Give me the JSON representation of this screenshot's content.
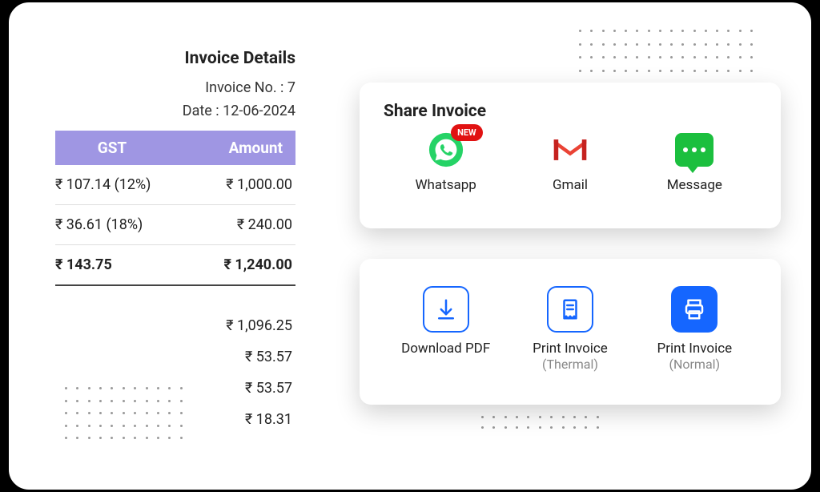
{
  "invoice": {
    "title": "Invoice Details",
    "invoice_no_label": "Invoice No. : 7",
    "date_label": "Date : 12-06-2024",
    "headers": {
      "gst": "GST",
      "amount": "Amount"
    },
    "rows": [
      {
        "gst": "₹ 107.14 (12%)",
        "amount": "₹ 1,000.00"
      },
      {
        "gst": "₹ 36.61 (18%)",
        "amount": "₹ 240.00"
      }
    ],
    "total": {
      "gst": "₹ 143.75",
      "amount": "₹ 1,240.00"
    },
    "extras": [
      "₹ 1,096.25",
      "₹ 53.57",
      "₹ 53.57",
      "₹ 18.31"
    ]
  },
  "share": {
    "title": "Share Invoice",
    "whatsapp": {
      "label": "Whatsapp",
      "badge": "NEW"
    },
    "gmail": {
      "label": "Gmail"
    },
    "message": {
      "label": "Message"
    }
  },
  "actions": {
    "download": {
      "label": "Download PDF"
    },
    "print_thermal": {
      "label": "Print Invoice",
      "sub": "(Thermal)"
    },
    "print_normal": {
      "label": "Print Invoice",
      "sub": "(Normal)"
    }
  }
}
